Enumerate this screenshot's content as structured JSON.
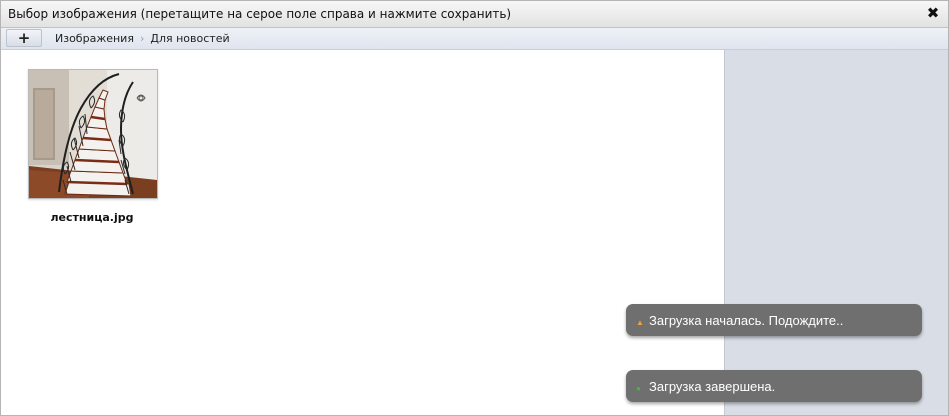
{
  "window": {
    "title": "Выбор изображения (перетащите на серое поле справа и нажмите сохранить)",
    "close_symbol": "✖"
  },
  "toolbar": {
    "add_label": "+",
    "breadcrumbs": [
      "Изображения",
      "Для новостей"
    ],
    "separator": "›"
  },
  "images": [
    {
      "filename": "лестница.jpg"
    }
  ],
  "notifications": [
    {
      "text": "Загрузка началась. Подождите..",
      "icon": "warning-icon",
      "color": "#f0a23a"
    },
    {
      "text": "Загрузка завершена.",
      "icon": "check-icon",
      "color": "#4caf50"
    }
  ]
}
